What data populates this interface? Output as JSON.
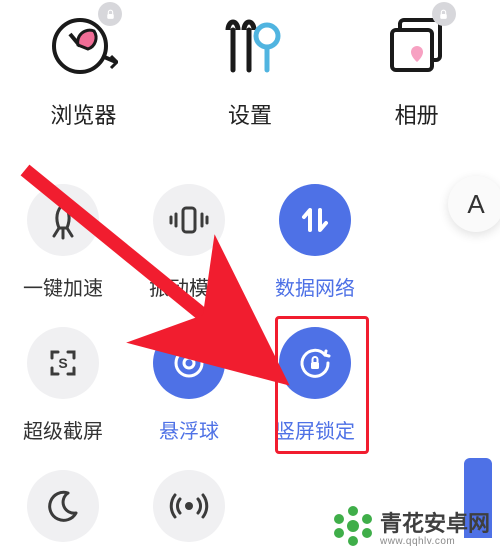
{
  "apps": {
    "browser": {
      "label": "浏览器"
    },
    "settings": {
      "label": "设置"
    },
    "gallery": {
      "label": "相册"
    }
  },
  "quick": {
    "boost": {
      "label": "一键加速",
      "active": false
    },
    "vibrate": {
      "label": "振动模式",
      "active": false
    },
    "data": {
      "label": "数据网络",
      "active": true
    },
    "shot": {
      "label": "超级截屏",
      "active": false
    },
    "float": {
      "label": "悬浮球",
      "active": true
    },
    "lock": {
      "label": "竖屏锁定",
      "active": true
    },
    "night": {
      "label": "",
      "active": false
    },
    "hotspot": {
      "label": "",
      "active": false
    }
  },
  "side_button": {
    "label": "A"
  },
  "watermark": {
    "main": "青花安卓网",
    "sub": "www.qqhlv.com"
  }
}
